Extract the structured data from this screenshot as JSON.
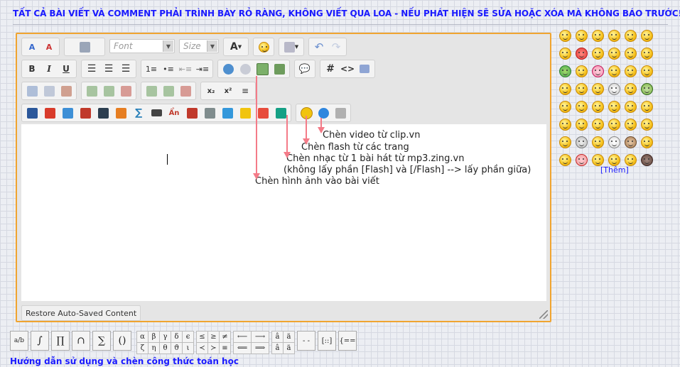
{
  "notice": "TẤT CẢ BÀI VIẾT VÀ COMMENT PHẢI TRÌNH BÀY RỎ RÀNG, KHÔNG VIẾT QUA LOA - NẾU PHÁT HIỆN SẼ SỬA HOẶC XÓA MÀ KHÔNG BÁO TRƯỚC!!!",
  "toolbar": {
    "font_placeholder": "Font",
    "size_placeholder": "Size",
    "font_color_label": "A",
    "bold": "B",
    "italic": "I",
    "underline": "U",
    "hash": "#",
    "code": "<>",
    "sub": "x₂",
    "sup": "x²"
  },
  "editor": {
    "notes": [
      "Chèn video từ clip.vn",
      "Chèn flash từ các trang",
      "Chèn nhạc từ 1 bài hát từ mp3.zing.vn",
      "(không lấy phần [Flash] và [/Flash] --> lấy phần giữa)",
      "Chèn hình ảnh vào bài viết"
    ],
    "restore_label": "Restore Auto-Saved Content"
  },
  "smilies_more": "[Thêm]",
  "math": {
    "frac": "a/b",
    "integral": "∫",
    "product": "∏",
    "cap": "∩",
    "sum": "∑",
    "paren": "()",
    "greek": [
      "α",
      "β",
      "γ",
      "δ",
      "ϵ",
      "ζ",
      "η",
      "θ",
      "ϑ",
      "ι",
      "κ"
    ],
    "relations": [
      "≤",
      "≥",
      "≠",
      "≺",
      "≻",
      "≡"
    ],
    "arrows": [
      "⟵",
      "⟶",
      "⟸",
      "⟹"
    ],
    "accents": [
      "â",
      "ä",
      "â",
      "ä"
    ],
    "help": "Hướng dẫn sử dụng và chèn công thức toán học"
  },
  "colors": {
    "accent_blue": "#1a1aff",
    "editor_border": "#f0a430",
    "arrow": "#f47b88"
  }
}
